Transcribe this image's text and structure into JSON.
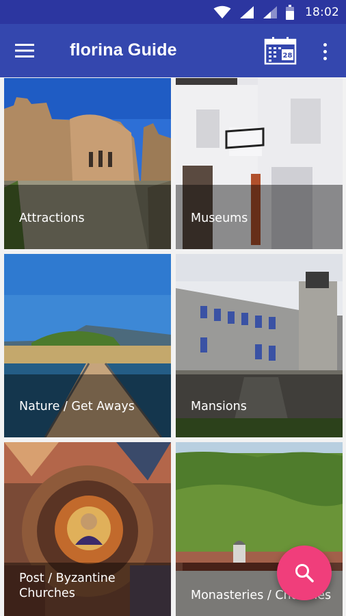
{
  "status_bar": {
    "time": "18:02",
    "icons": [
      "wifi-icon",
      "signal-icon",
      "signal-weak-icon",
      "battery-icon"
    ]
  },
  "app_bar": {
    "title": "florina Guide",
    "menu_icon": "hamburger-menu-icon",
    "calendar_icon": "calendar-icon",
    "calendar_day": "28",
    "more_icon": "more-vertical-icon",
    "background_color": "#3447ae",
    "status_color": "#2c36a0"
  },
  "categories": [
    {
      "label": "Attractions"
    },
    {
      "label": "Museums"
    },
    {
      "label": "Nature / Get Aways"
    },
    {
      "label": "Mansions"
    },
    {
      "label": "Post / Byzantine\nChurches"
    },
    {
      "label": "Monasteries / Churches"
    }
  ],
  "fab": {
    "icon": "search-icon",
    "color": "#f03e7b"
  }
}
